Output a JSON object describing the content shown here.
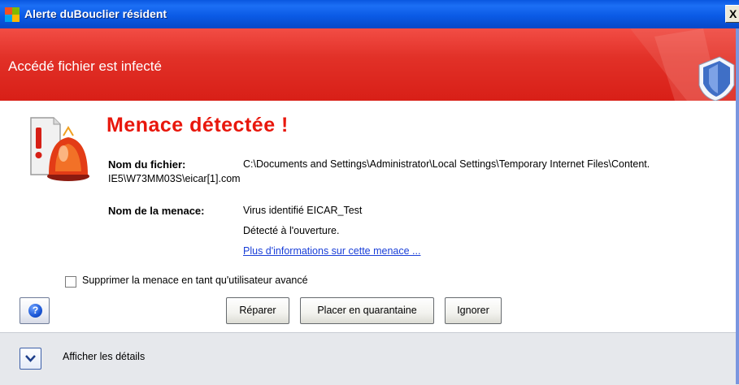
{
  "window": {
    "title": "Alerte duBouclier résident",
    "close_glyph": "X"
  },
  "header": {
    "text": "Accédé fichier est infecté"
  },
  "threat": {
    "title": "Menace détectée !",
    "file_label": "Nom du fichier:",
    "file_path_line1": "C:\\Documents and Settings\\Administrator\\Local Settings\\Temporary Internet Files\\Content.",
    "file_path_line2": "IE5\\W73MM03S\\eicar[1].com",
    "threat_label": "Nom de la menace:",
    "threat_name": "Virus identifié EICAR_Test",
    "detected_on": "Détecté à l'ouverture.",
    "more_info_link": "Plus d'informations sur cette menace ..."
  },
  "options": {
    "advanced_checkbox_label": "Supprimer la menace en tant qu'utilisateur avancé",
    "advanced_checked": false
  },
  "buttons": {
    "help_glyph": "?",
    "repair": "Réparer",
    "quarantine": "Placer en quarantaine",
    "ignore": "Ignorer"
  },
  "footer": {
    "details_label": "Afficher les détails"
  },
  "icons": {
    "app": "avg-logo-icon",
    "header_decoration": "shield-icon",
    "threat": "warning-siren-icon",
    "help": "help-icon",
    "expand": "chevron-down-icon"
  },
  "colors": {
    "header_red": "#e23128",
    "threat_title": "#e8170c",
    "link": "#1a3fd8",
    "titlebar_blue": "#0b5be6"
  }
}
